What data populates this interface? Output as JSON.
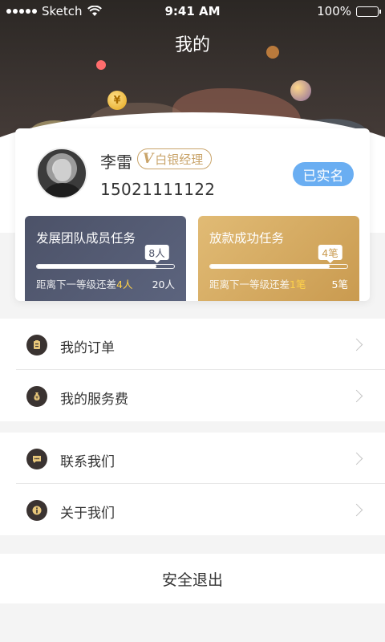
{
  "status_bar": {
    "carrier": "Sketch",
    "time": "9:41 AM",
    "battery": "100%"
  },
  "header": {
    "title": "我的",
    "coin_symbol": "¥"
  },
  "profile": {
    "name": "李雷",
    "level_letter": "V",
    "level": "白银经理",
    "phone": "15021111122",
    "verified_label": "已实名"
  },
  "tasks": [
    {
      "title": "发展团队成员任务",
      "current": "8人",
      "progress": 0.87,
      "note_prefix": "距离下一等级还差",
      "note_value": "4人",
      "target": "20人"
    },
    {
      "title": "放款成功任务",
      "current": "4笔",
      "progress": 0.87,
      "note_prefix": "距离下一等级还差",
      "note_value": "1笔",
      "target": "5笔"
    }
  ],
  "menu": {
    "group1": [
      {
        "label": "我的订单",
        "icon": "clipboard-icon"
      },
      {
        "label": "我的服务费",
        "icon": "money-bag-icon"
      }
    ],
    "group2": [
      {
        "label": "联系我们",
        "icon": "chat-bubble-icon"
      },
      {
        "label": "关于我们",
        "icon": "info-icon"
      }
    ]
  },
  "logout_label": "安全退出",
  "colors": {
    "verified": "#6aaef2",
    "gold": "#c9a46a",
    "highlight": "#ffd24a",
    "dark": "#2b2724"
  }
}
